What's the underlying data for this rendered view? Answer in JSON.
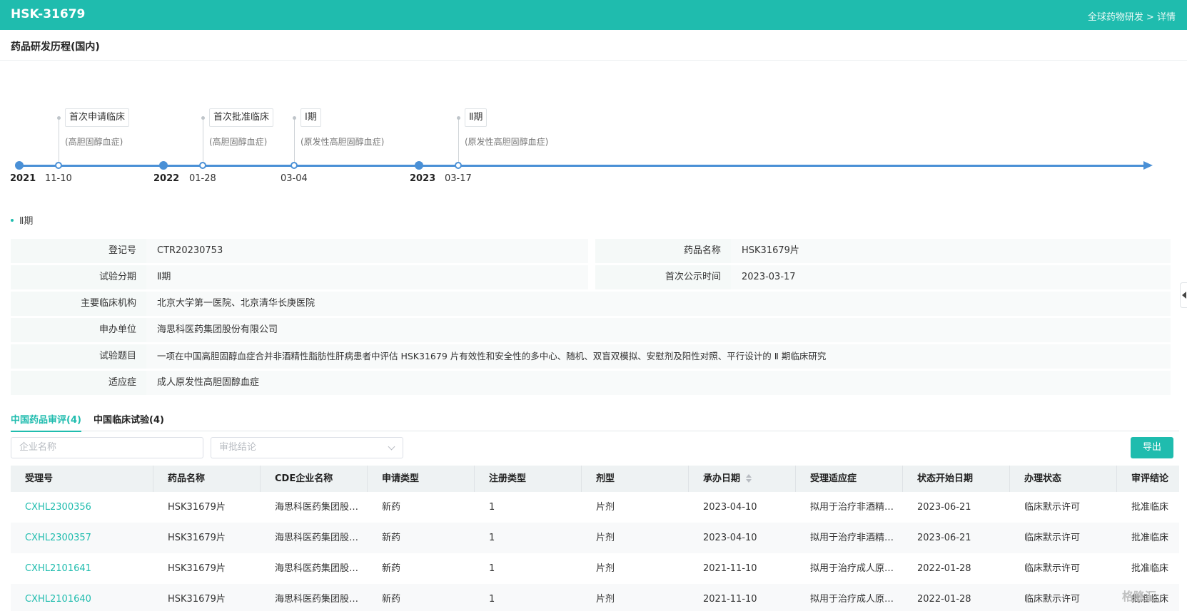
{
  "header": {
    "title": "HSK-31679",
    "breadcrumb": "全球药物研发 > 详情"
  },
  "section_title": "药品研发历程(国内)",
  "timeline": {
    "years": [
      "2021",
      "2022",
      "2023"
    ],
    "events": [
      {
        "date": "11-10",
        "label": "首次申请临床",
        "sub": "(高胆固醇血症)"
      },
      {
        "date": "01-28",
        "label": "首次批准临床",
        "sub": "(高胆固醇血症)"
      },
      {
        "date": "03-04",
        "label": "Ⅰ期",
        "sub": "(原发性高胆固醇血症)"
      },
      {
        "date": "03-17",
        "label": "Ⅱ期",
        "sub": "(原发性高胆固醇血症)"
      }
    ]
  },
  "phase_tag": "Ⅱ期",
  "info": {
    "reg_no_label": "登记号",
    "reg_no": "CTR20230753",
    "drug_name_label": "药品名称",
    "drug_name": "HSK31679片",
    "trial_phase_label": "试验分期",
    "trial_phase": "Ⅱ期",
    "first_public_label": "首次公示时间",
    "first_public": "2023-03-17",
    "institution_label": "主要临床机构",
    "institution": "北京大学第一医院、北京清华长庚医院",
    "sponsor_label": "申办单位",
    "sponsor": "海思科医药集团股份有限公司",
    "title_label": "试验题目",
    "title": "一项在中国高胆固醇血症合并非酒精性脂肪性肝病患者中评估 HSK31679 片有效性和安全性的多中心、随机、双盲双模拟、安慰剂及阳性对照、平行设计的 Ⅱ 期临床研究",
    "indication_label": "适应症",
    "indication": "成人原发性高胆固醇血症"
  },
  "tabs": [
    "中国药品审评(4)",
    "中国临床试验(4)"
  ],
  "filters": {
    "company_placeholder": "企业名称",
    "conclusion_placeholder": "审批结论"
  },
  "export_label": "导出",
  "table": {
    "columns": [
      "受理号",
      "药品名称",
      "CDE企业名称",
      "申请类型",
      "注册类型",
      "剂型",
      "承办日期",
      "受理适应症",
      "状态开始日期",
      "办理状态",
      "审评结论"
    ],
    "rows": [
      [
        "CXHL2300356",
        "HSK31679片",
        "海思科医药集团股…",
        "新药",
        "1",
        "片剂",
        "2023-04-10",
        "拟用于治疗非酒精…",
        "2023-06-21",
        "临床默示许可",
        "批准临床"
      ],
      [
        "CXHL2300357",
        "HSK31679片",
        "海思科医药集团股…",
        "新药",
        "1",
        "片剂",
        "2023-04-10",
        "拟用于治疗非酒精…",
        "2023-06-21",
        "临床默示许可",
        "批准临床"
      ],
      [
        "CXHL2101641",
        "HSK31679片",
        "海思科医药集团股…",
        "新药",
        "1",
        "片剂",
        "2021-11-10",
        "拟用于治疗成人原…",
        "2022-01-28",
        "临床默示许可",
        "批准临床"
      ],
      [
        "CXHL2101640",
        "HSK31679片",
        "海思科医药集团股…",
        "新药",
        "1",
        "片剂",
        "2021-11-10",
        "拟用于治疗成人原…",
        "2022-01-28",
        "临床默示许可",
        "批准临床"
      ]
    ]
  },
  "watermark": "格隆汇"
}
